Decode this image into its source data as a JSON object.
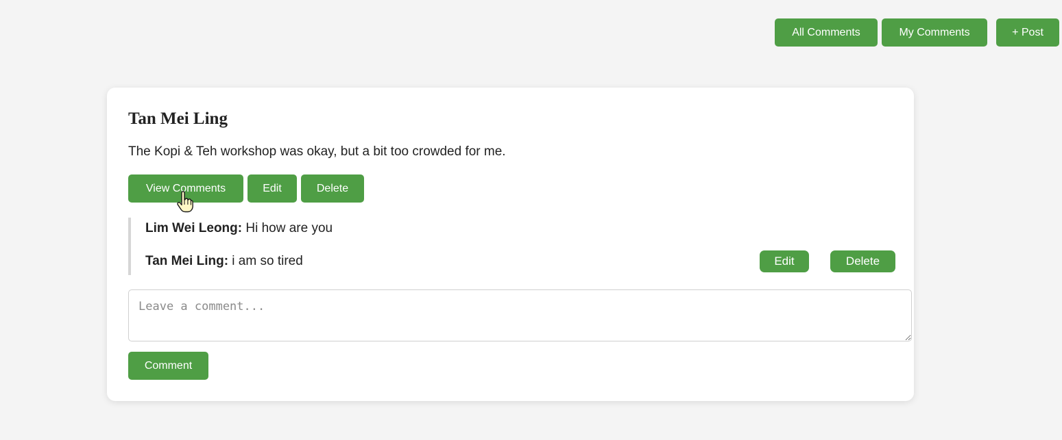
{
  "nav": {
    "all_comments": "All Comments",
    "my_comments": "My Comments",
    "post": "+ Post"
  },
  "post": {
    "author": "Tan Mei Ling",
    "body": "The Kopi & Teh workshop was okay, but a bit too crowded for me.",
    "view_comments_label": "View Comments",
    "edit_label": "Edit",
    "delete_label": "Delete"
  },
  "comments": [
    {
      "author": "Lim Wei Leong:",
      "text": " Hi how are you"
    },
    {
      "author": "Tan Mei Ling:",
      "text": " i am so tired",
      "edit_label": "Edit",
      "delete_label": "Delete"
    }
  ],
  "new_comment": {
    "placeholder": "Leave a comment...",
    "submit_label": "Comment"
  },
  "colors": {
    "accent": "#4f9e45",
    "background": "#f4f4f4",
    "card": "#ffffff"
  },
  "icons": {
    "cursor": "hand-pointer-icon"
  }
}
